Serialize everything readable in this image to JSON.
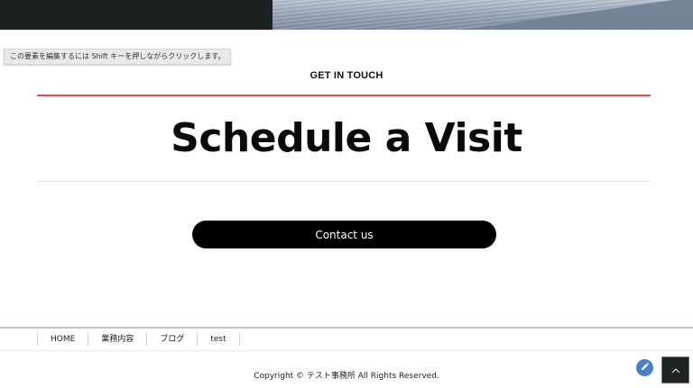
{
  "hint": {
    "text": "この要素を編集するには Shift キーを押しながらクリックします。"
  },
  "section": {
    "eyebrow": "GET IN TOUCH",
    "title": "Schedule a Visit",
    "cta_label": "Contact us"
  },
  "footer": {
    "nav": [
      {
        "label": "HOME"
      },
      {
        "label": "業務内容"
      },
      {
        "label": "ブログ"
      },
      {
        "label": "test"
      }
    ],
    "copyright": "Copyright © テスト事務所 All Rights Reserved."
  },
  "icons": {
    "edit": "pencil-icon",
    "back_to_top": "chevron-up-icon"
  },
  "colors": {
    "accent_rule": "#d9534f",
    "cta_background": "#000000",
    "edit_button": "#4a7fc1"
  }
}
